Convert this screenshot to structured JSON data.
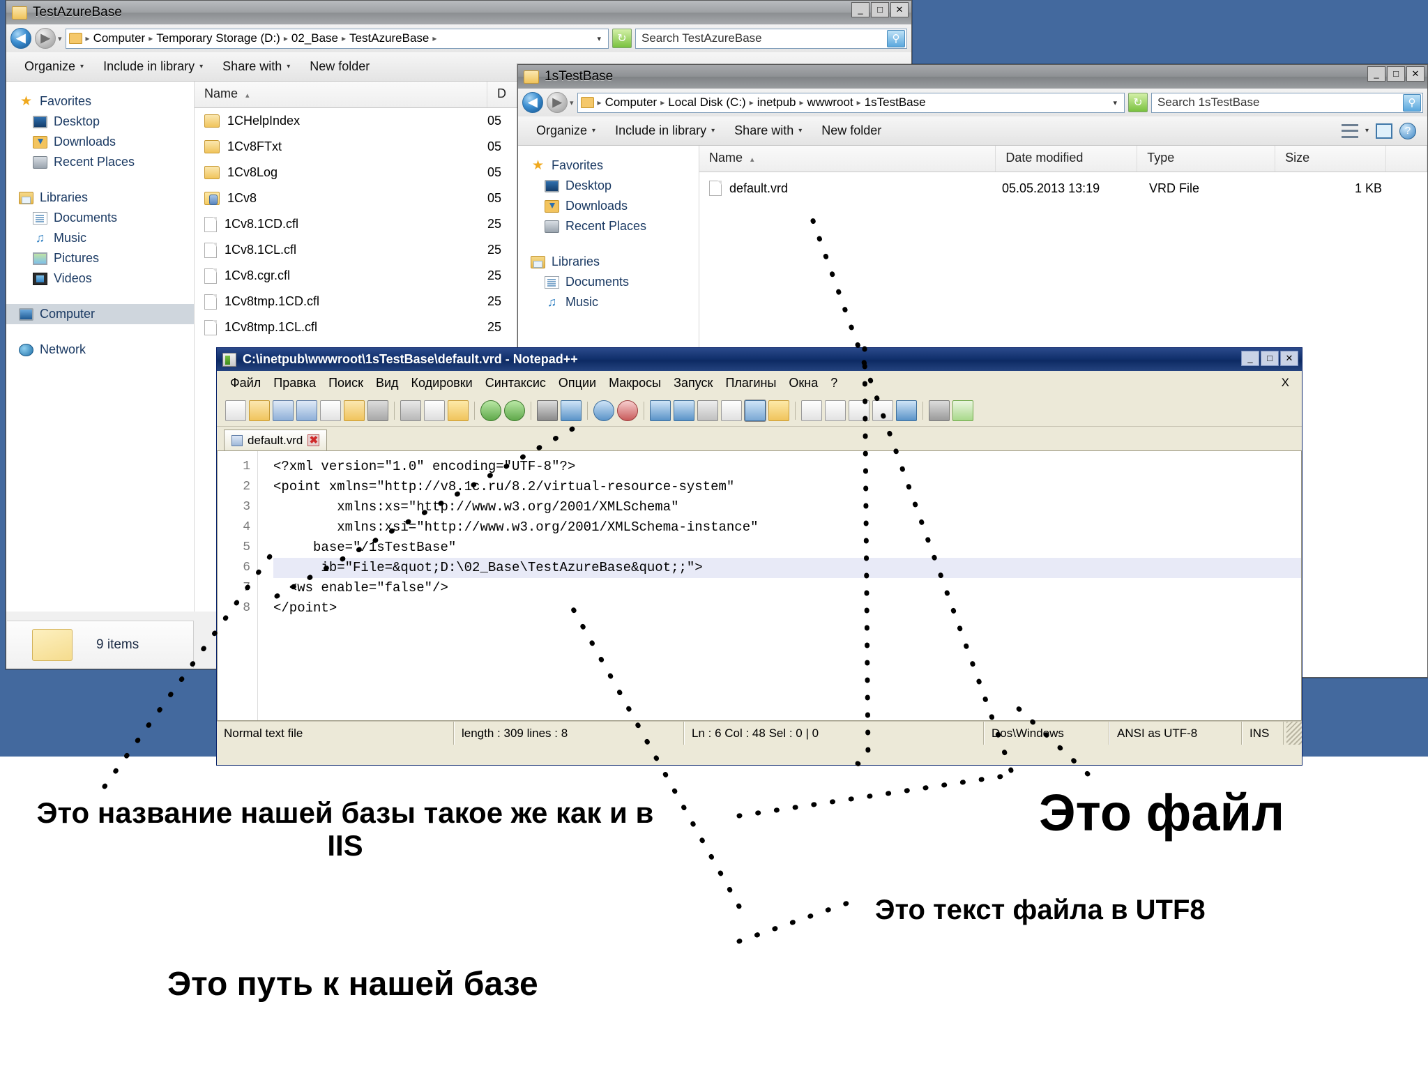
{
  "windows": {
    "explorer1": {
      "title": "TestAzureBase",
      "min_label": "_",
      "max_label": "□",
      "close_label": "✕",
      "back_label": "◀",
      "fwd_label": "▶",
      "nav_drop": "▾",
      "breadcrumbs": [
        "Computer",
        "Temporary Storage (D:)",
        "02_Base",
        "TestAzureBase"
      ],
      "addr_caret": "▾",
      "refresh_label": "↻",
      "search_placeholder": "Search TestAzureBase",
      "search_icon": "🔍",
      "commands": [
        "Organize",
        "Include in library",
        "Share with",
        "New folder"
      ],
      "command_caret": "▾",
      "nav_items": [
        {
          "label": "Favorites",
          "icon": "star-icon",
          "level": 0
        },
        {
          "label": "Desktop",
          "icon": "desktop-icon",
          "level": 1
        },
        {
          "label": "Downloads",
          "icon": "downloads-icon",
          "level": 1
        },
        {
          "label": "Recent Places",
          "icon": "recent-places-icon",
          "level": 1
        },
        {
          "label": "Libraries",
          "icon": "library-icon",
          "level": 0
        },
        {
          "label": "Documents",
          "icon": "document-icon",
          "level": 1
        },
        {
          "label": "Music",
          "icon": "music-icon",
          "level": 1
        },
        {
          "label": "Pictures",
          "icon": "pictures-icon",
          "level": 1
        },
        {
          "label": "Videos",
          "icon": "videos-icon",
          "level": 1
        },
        {
          "label": "Computer",
          "icon": "computer-icon",
          "level": 0
        },
        {
          "label": "Network",
          "icon": "network-icon",
          "level": 0
        }
      ],
      "columns": [
        "Name",
        "D"
      ],
      "sort_mark": "▴",
      "files": [
        {
          "name": "1CHelpIndex",
          "kind": "folder",
          "date": "05"
        },
        {
          "name": "1Cv8FTxt",
          "kind": "folder",
          "date": "05"
        },
        {
          "name": "1Cv8Log",
          "kind": "folder",
          "date": "05"
        },
        {
          "name": "1Cv8",
          "kind": "database",
          "date": "05"
        },
        {
          "name": "1Cv8.1CD.cfl",
          "kind": "file",
          "date": "25"
        },
        {
          "name": "1Cv8.1CL.cfl",
          "kind": "file",
          "date": "25"
        },
        {
          "name": "1Cv8.cgr.cfl",
          "kind": "file",
          "date": "25"
        },
        {
          "name": "1Cv8tmp.1CD.cfl",
          "kind": "file",
          "date": "25"
        },
        {
          "name": "1Cv8tmp.1CL.cfl",
          "kind": "file",
          "date": "25"
        }
      ],
      "status_text": "9 items"
    },
    "explorer2": {
      "title": "1sTestBase",
      "min_label": "_",
      "max_label": "□",
      "close_label": "✕",
      "back_label": "◀",
      "fwd_label": "▶",
      "nav_drop": "▾",
      "breadcrumbs": [
        "Computer",
        "Local Disk (C:)",
        "inetpub",
        "wwwroot",
        "1sTestBase"
      ],
      "addr_caret": "▾",
      "refresh_label": "↻",
      "search_placeholder": "Search 1sTestBase",
      "search_icon": "🔍",
      "commands": [
        "Organize",
        "Include in library",
        "Share with",
        "New folder"
      ],
      "command_caret": "▾",
      "view_caret": "▾",
      "help_label": "?",
      "nav_items": [
        {
          "label": "Favorites",
          "icon": "star-icon",
          "level": 0
        },
        {
          "label": "Desktop",
          "icon": "desktop-icon",
          "level": 1
        },
        {
          "label": "Downloads",
          "icon": "downloads-icon",
          "level": 1
        },
        {
          "label": "Recent Places",
          "icon": "recent-places-icon",
          "level": 1
        },
        {
          "label": "Libraries",
          "icon": "library-icon",
          "level": 0
        },
        {
          "label": "Documents",
          "icon": "document-icon",
          "level": 1
        },
        {
          "label": "Music",
          "icon": "music-icon",
          "level": 1
        }
      ],
      "columns": [
        "Name",
        "Date modified",
        "Type",
        "Size"
      ],
      "sort_mark": "▴",
      "files": [
        {
          "name": "default.vrd",
          "date": "05.05.2013 13:19",
          "type": "VRD File",
          "size": "1 KB"
        }
      ]
    },
    "notepadpp": {
      "title": "C:\\inetpub\\wwwroot\\1sTestBase\\default.vrd - Notepad++",
      "min_label": "_",
      "max_label": "□",
      "close_label": "✕",
      "menu": [
        "Файл",
        "Правка",
        "Поиск",
        "Вид",
        "Кодировки",
        "Синтаксис",
        "Опции",
        "Макросы",
        "Запуск",
        "Плагины",
        "Окна",
        "?"
      ],
      "menu_close": "X",
      "tab_label": "default.vrd",
      "tab_close": "✖",
      "line_numbers": [
        "1",
        "2",
        "3",
        "4",
        "5",
        "6",
        "7",
        "8"
      ],
      "code_lines": [
        {
          "n": 1,
          "text": "<?xml version=\"1.0\" encoding=\"UTF-8\"?>",
          "highlight": false
        },
        {
          "n": 2,
          "text": "<point xmlns=\"http://v8.1c.ru/8.2/virtual-resource-system\"",
          "highlight": false
        },
        {
          "n": 3,
          "text": "        xmlns:xs=\"http://www.w3.org/2001/XMLSchema\"",
          "highlight": false
        },
        {
          "n": 4,
          "text": "        xmlns:xsi=\"http://www.w3.org/2001/XMLSchema-instance\"",
          "highlight": false
        },
        {
          "n": 5,
          "text": "     base=\"/1sTestBase\"",
          "highlight": false
        },
        {
          "n": 6,
          "text": "      ib=\"File=&quot;D:\\02_Base\\TestAzureBase&quot;;\">",
          "highlight": true
        },
        {
          "n": 7,
          "text": "  <ws enable=\"false\"/>",
          "highlight": false
        },
        {
          "n": 8,
          "text": "</point>",
          "highlight": false
        }
      ],
      "status": {
        "file_type": "Normal text file",
        "length_lines": "length : 309   lines : 8",
        "caret": "Ln : 6   Col : 48   Sel : 0 | 0",
        "eol": "Dos\\Windows",
        "encoding": "ANSI as UTF-8",
        "insert_mode": "INS"
      }
    }
  },
  "annotations": {
    "db_name": "Это название нашей базы такое же как и в IIS",
    "file": "Это файл",
    "utf8": "Это текст файла в UTF8",
    "path": "Это путь к нашей базе"
  },
  "colors": {
    "desktop": "#43699e",
    "npp_title": "#12316e",
    "highlight_line": "#e8eaf7"
  }
}
